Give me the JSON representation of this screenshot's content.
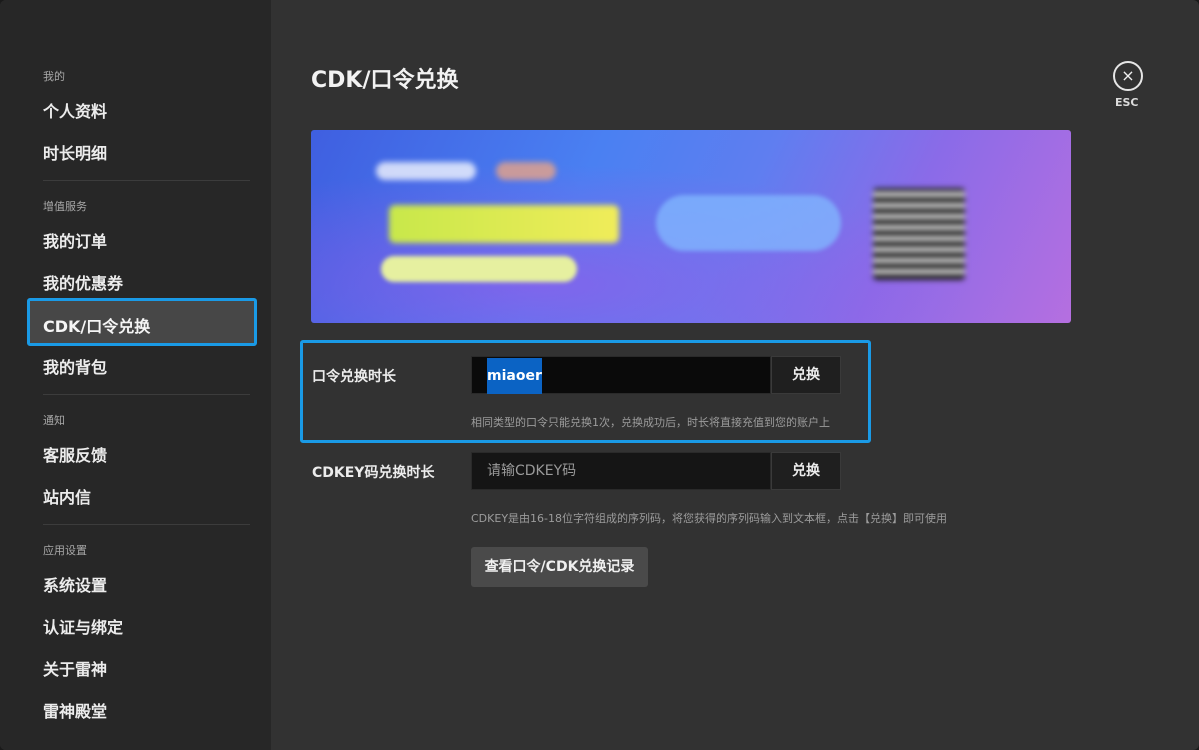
{
  "sidebar": {
    "sections": [
      {
        "title": "我的",
        "items": [
          "个人资料",
          "时长明细"
        ]
      },
      {
        "title": "增值服务",
        "items": [
          "我的订单",
          "我的优惠券",
          "CDK/口令兑换",
          "我的背包"
        ]
      },
      {
        "title": "通知",
        "items": [
          "客服反馈",
          "站内信"
        ]
      },
      {
        "title": "应用设置",
        "items": [
          "系统设置",
          "认证与绑定",
          "关于雷神",
          "雷神殿堂"
        ]
      }
    ],
    "active_item": "CDK/口令兑换"
  },
  "main": {
    "title": "CDK/口令兑换",
    "close_icon": "×",
    "close_label": "ESC",
    "password_row": {
      "label": "口令兑换时长",
      "value": "miaoer",
      "button": "兑换",
      "hint": "相同类型的口令只能兑换1次，兑换成功后，时长将直接充值到您的账户上"
    },
    "cdkey_row": {
      "label": "CDKEY码兑换时长",
      "placeholder": "请输CDKEY码",
      "button": "兑换",
      "hint": "CDKEY是由16-18位字符组成的序列码，将您获得的序列码输入到文本框，点击【兑换】即可使用"
    },
    "history_button": "查看口令/CDK兑换记录"
  },
  "colors": {
    "accent": "#1a9ae6",
    "selection": "#0b63c4",
    "sidebar_bg": "#272727",
    "main_bg": "#323232"
  }
}
